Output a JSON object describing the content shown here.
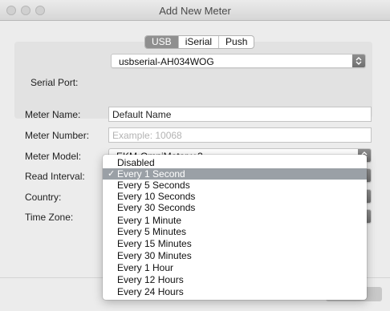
{
  "window": {
    "title": "Add New Meter"
  },
  "connection_tabs": [
    "USB",
    "iSerial",
    "Push"
  ],
  "active_tab_index": 0,
  "serial_port": {
    "label": "Serial Port:",
    "value": "usbserial-AH034WOG"
  },
  "form": {
    "meter_name": {
      "label": "Meter Name:",
      "value": "Default Name"
    },
    "meter_number": {
      "label": "Meter Number:",
      "placeholder": "Example: 10068"
    },
    "meter_model": {
      "label": "Meter Model:",
      "value": "EKM-OmniMeter v.3"
    },
    "read_interval": {
      "label": "Read Interval:"
    },
    "country": {
      "label": "Country:"
    },
    "time_zone": {
      "label": "Time Zone:"
    }
  },
  "read_interval_menu": {
    "selected": "Every 1 Second",
    "items": [
      "Disabled",
      "Every 1 Second",
      "Every 5 Seconds",
      "Every 10 Seconds",
      "Every 30 Seconds",
      "Every 1 Minute",
      "Every 5 Minutes",
      "Every 15 Minutes",
      "Every 30 Minutes",
      "Every 1 Hour",
      "Every 12 Hours",
      "Every 24 Hours"
    ],
    "check_glyph": "✓"
  },
  "colors": {
    "selection": "#9aa0a6",
    "segment_active": "#8f8f8f",
    "window_bg": "#ececec"
  },
  "icons": {
    "stepper": "up-down-chevron-icon"
  }
}
